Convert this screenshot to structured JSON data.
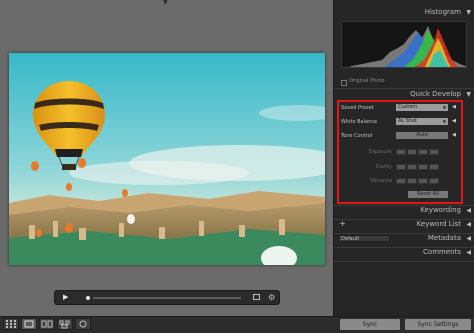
{
  "panel": {
    "histogram_title": "Histogram",
    "original_photo_label": "Original Photo",
    "quick_develop": {
      "title": "Quick Develop",
      "saved_preset_label": "Saved Preset",
      "saved_preset_value": "Custom",
      "white_balance_label": "White Balance",
      "white_balance_value": "As Shot",
      "tone_control_label": "Tone Control",
      "auto_label": "Auto",
      "exposure_label": "Exposure",
      "clarity_label": "Clarity",
      "vibrance_label": "Vibrance",
      "reset_label": "Reset All"
    },
    "keywording": "Keywording",
    "keyword_list": "Keyword List",
    "metadata": "Metadata",
    "metadata_preset": "Default",
    "comments": "Comments"
  },
  "toolbar": {
    "sync_label": "Sync",
    "sync_settings_label": "Sync Settings"
  },
  "icons": {
    "play": "play-icon",
    "frame": "frame-icon",
    "settings": "gear-icon",
    "grid": "grid-view-icon",
    "loupe": "loupe-view-icon",
    "compare": "compare-view-icon",
    "survey": "survey-view-icon"
  },
  "colors": {
    "highlight_border": "#e0161b",
    "panel_bg": "#262626",
    "canvas_bg": "#6b6b6b"
  }
}
